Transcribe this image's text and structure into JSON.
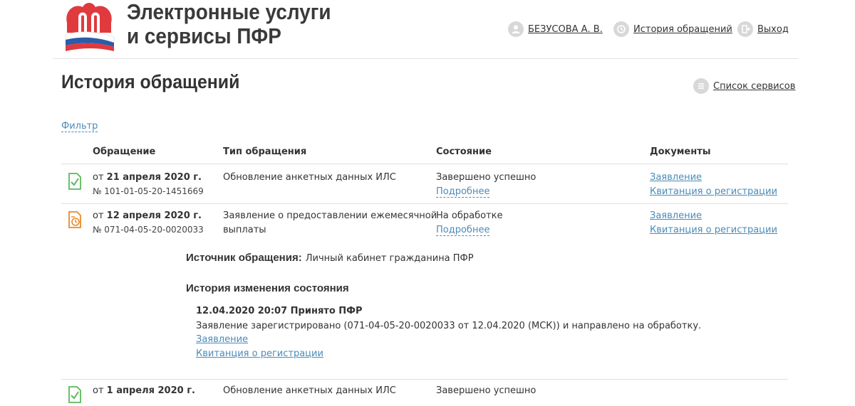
{
  "header": {
    "title_line1": "Электронные услуги",
    "title_line2": "и сервисы ПФР",
    "user_name": "БЕЗУСОВА А. В.",
    "history_link": "История обращений",
    "logout_link": "Выход"
  },
  "page": {
    "title": "История обращений",
    "services_link": "Список сервисов",
    "filter_link": "Фильтр"
  },
  "table": {
    "columns": [
      "Обращение",
      "Тип обращения",
      "Состояние",
      "Документы"
    ],
    "rows": [
      {
        "date_prefix": "от",
        "date": "21 апреля 2020 г.",
        "number": "№ 101-01-05-20-1451669",
        "type": "Обновление анкетных данных ИЛС",
        "status": "Завершено успешно",
        "details_link": "Подробнее",
        "doc1": "Заявление",
        "doc2": "Квитанция о регистрации",
        "status_icon": "document-check-icon"
      },
      {
        "date_prefix": "от",
        "date": "12 апреля 2020 г.",
        "number": "№ 071-04-05-20-0020033",
        "type_line1": "Заявление о предоставлении ежемесячной",
        "type_line2": "выплаты",
        "status": "На обработке",
        "details_link": "Подробнее",
        "doc1": "Заявление",
        "doc2": "Квитанция о регистрации",
        "status_icon": "document-clock-icon"
      },
      {
        "date_prefix": "от",
        "date": "1 апреля 2020 г.",
        "type": "Обновление анкетных данных ИЛС",
        "status": "Завершено успешно",
        "status_icon": "document-check-icon"
      }
    ]
  },
  "details": {
    "source_label": "Источник обращения:",
    "source_value": "Личный кабинет гражданина ПФР",
    "history_title": "История изменения состояния",
    "event_title": "12.04.2020 20:07 Принято ПФР",
    "event_text": "Заявление зарегистрировано (071-04-05-20-0020033 от 12.04.2020 (МСК)) и направлено на обработку.",
    "event_doc1": "Заявление",
    "event_doc2": "Квитанция о регистрации"
  },
  "colors": {
    "link": "#4a8bb8",
    "success_icon": "#5cb85c",
    "processing_icon": "#e98a2a",
    "logo_red": "#e03a3e"
  }
}
